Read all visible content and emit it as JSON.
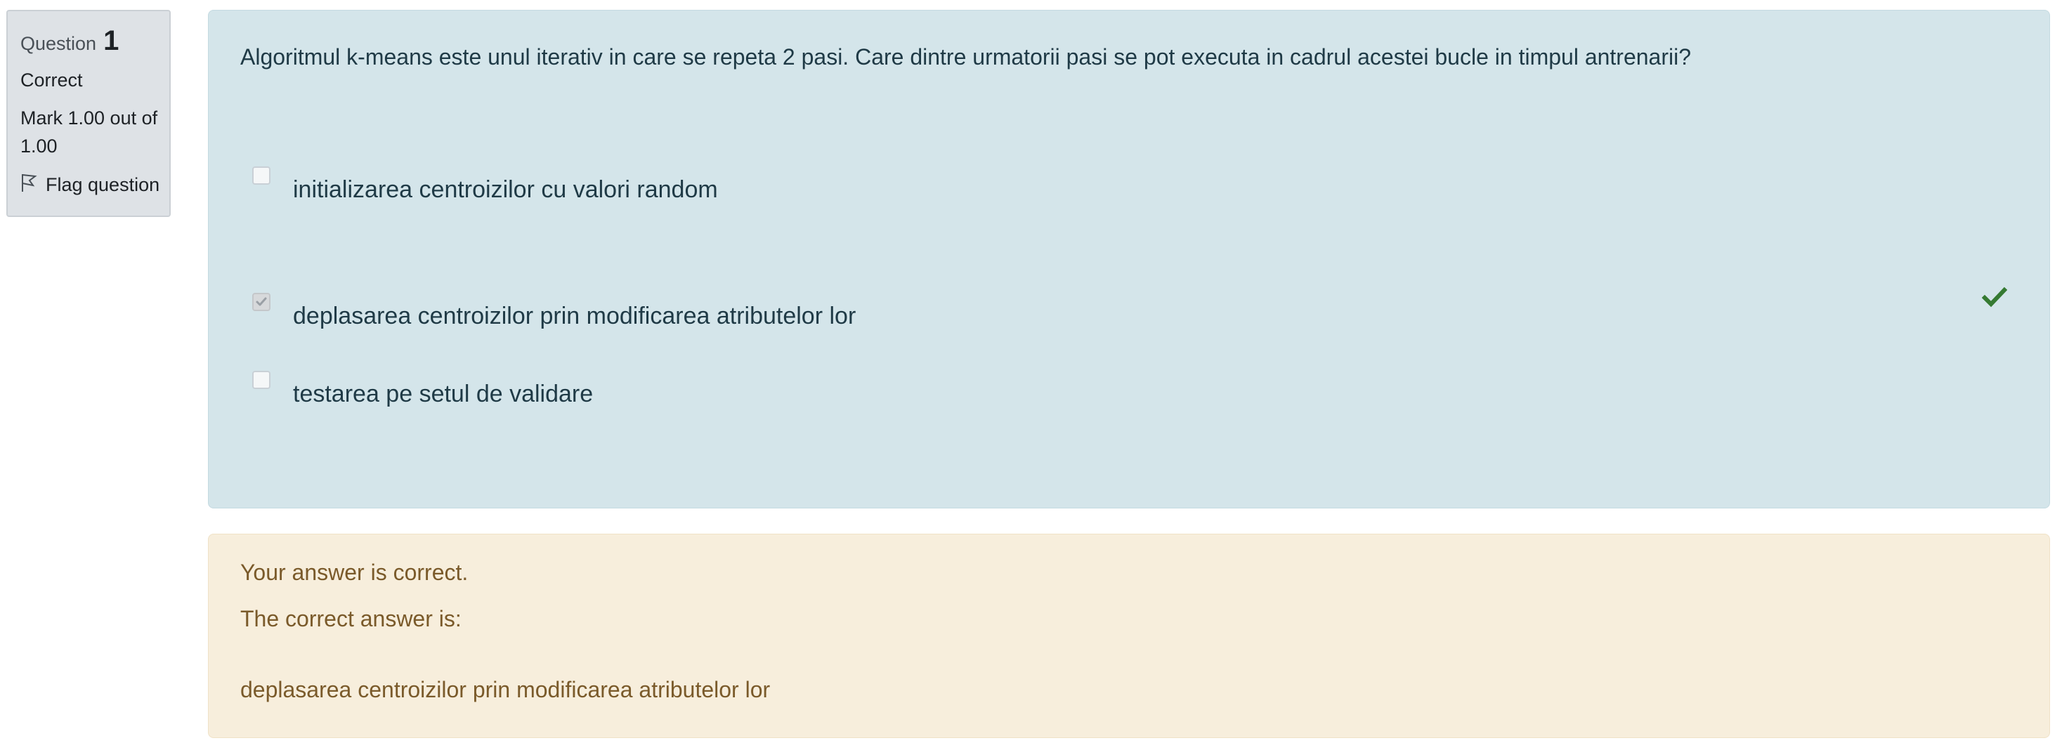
{
  "info": {
    "question_label": "Question",
    "question_number": "1",
    "state": "Correct",
    "grade": "Mark 1.00 out of 1.00",
    "flag_label": "Flag question"
  },
  "question": {
    "text": "Algoritmul k-means este unul iterativ in care se repeta 2 pasi. Care dintre urmatorii pasi se pot executa in cadrul acestei bucle in timpul antrenarii?",
    "answers": [
      {
        "label": "initializarea centroizilor cu valori random",
        "checked": false
      },
      {
        "label": "deplasarea centroizilor prin modificarea atributelor lor",
        "checked": true,
        "mark": "correct"
      },
      {
        "label": "testarea pe setul de validare",
        "checked": false
      }
    ]
  },
  "feedback": {
    "summary": "Your answer is correct.",
    "correct_intro": "The correct answer is:",
    "correct_answer": "deplasarea centroizilor prin modificarea atributelor lor"
  },
  "colors": {
    "question_bg": "#d4e5ea",
    "feedback_bg": "#f7eedc",
    "info_bg": "#dee2e6",
    "correct_icon": "#357a32"
  },
  "icons": {
    "flag": "flag-outline-icon",
    "correct": "check-icon"
  }
}
